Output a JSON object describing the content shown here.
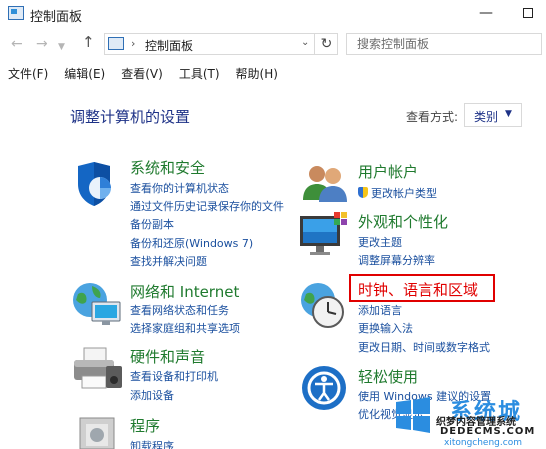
{
  "window": {
    "title": "控制面板"
  },
  "address": {
    "crumb": "控制面板",
    "search_placeholder": "搜索控制面板"
  },
  "menu": [
    "文件(F)",
    "编辑(E)",
    "查看(V)",
    "工具(T)",
    "帮助(H)"
  ],
  "heading": "调整计算机的设置",
  "view_by": {
    "label": "查看方式:",
    "value": "类别"
  },
  "categories": {
    "system": {
      "title": "系统和安全",
      "links": [
        "查看你的计算机状态",
        "通过文件历史记录保存你的文件",
        "备份副本",
        "备份和还原(Windows 7)",
        "查找并解决问题"
      ]
    },
    "network": {
      "title": "网络和 Internet",
      "links": [
        "查看网络状态和任务",
        "选择家庭组和共享选项"
      ]
    },
    "hardware": {
      "title": "硬件和声音",
      "links": [
        "查看设备和打印机",
        "添加设备"
      ]
    },
    "programs": {
      "title": "程序",
      "links": [
        "卸载程序"
      ]
    },
    "user": {
      "title": "用户帐户",
      "links": [
        "更改帐户类型"
      ]
    },
    "appearance": {
      "title": "外观和个性化",
      "links": [
        "更改主题",
        "调整屏幕分辨率"
      ]
    },
    "clock": {
      "title": "时钟、语言和区域",
      "links": [
        "添加语言",
        "更换输入法",
        "更改日期、时间或数字格式"
      ]
    },
    "ease": {
      "title": "轻松使用",
      "links": [
        "使用 Windows 建议的设置",
        "优化视觉显示"
      ]
    }
  },
  "watermark": {
    "brand": "系统城",
    "line1": "织梦内容管理系统",
    "line2": "DEDECMS.COM",
    "url": "xitongcheng.com"
  },
  "colors": {
    "category_title": "#1f7a2e",
    "link": "#1a4f9e",
    "highlight": "#e00000"
  }
}
